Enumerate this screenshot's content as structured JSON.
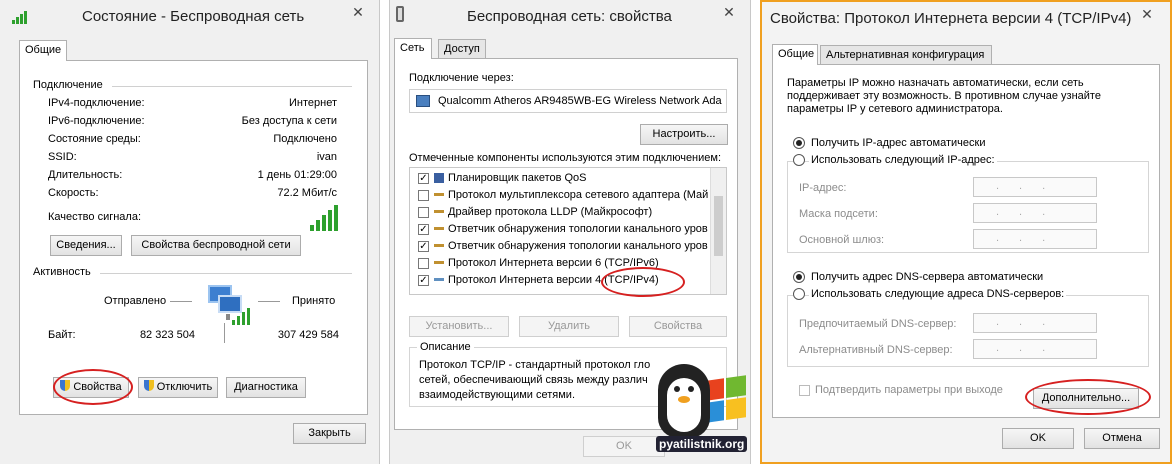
{
  "w1": {
    "title": "Состояние - Беспроводная сеть",
    "tab_general": "Общие",
    "section_connection": "Подключение",
    "rows": [
      {
        "label": "IPv4-подключение:",
        "value": "Интернет"
      },
      {
        "label": "IPv6-подключение:",
        "value": "Без доступа к сети"
      },
      {
        "label": "Состояние среды:",
        "value": "Подключено"
      },
      {
        "label": "SSID:",
        "value": "ivan"
      },
      {
        "label": "Длительность:",
        "value": "1 день 01:29:00"
      },
      {
        "label": "Скорость:",
        "value": "72.2 Мбит/с"
      }
    ],
    "signal_label": "Качество сигнала:",
    "btn_details": "Сведения...",
    "btn_wireless_props": "Свойства беспроводной сети",
    "section_activity": "Активность",
    "sent_label": "Отправлено",
    "received_label": "Принято",
    "bytes_label": "Байт:",
    "bytes_sent": "82 323 504",
    "bytes_received": "307 429 584",
    "btn_properties": "Свойства",
    "btn_disable": "Отключить",
    "btn_diagnose": "Диагностика",
    "btn_close": "Закрыть"
  },
  "w2": {
    "title": "Беспроводная сеть: свойства",
    "tab_network": "Сеть",
    "tab_access": "Доступ",
    "connect_via_label": "Подключение через:",
    "adapter_name": "Qualcomm Atheros AR9485WB-EG Wireless Network Ada",
    "btn_configure": "Настроить...",
    "components_label": "Отмеченные компоненты используются этим подключением:",
    "components": [
      {
        "checked": true,
        "label": "Планировщик пакетов QoS"
      },
      {
        "checked": false,
        "label": "Протокол мультиплексора сетевого адаптера (Май"
      },
      {
        "checked": false,
        "label": "Драйвер протокола LLDP (Майкрософт)"
      },
      {
        "checked": true,
        "label": "Ответчик обнаружения топологии канального уров"
      },
      {
        "checked": true,
        "label": "Ответчик обнаружения топологии канального уров"
      },
      {
        "checked": false,
        "label": "Протокол Интернета версии 6 (TCP/IPv6)"
      },
      {
        "checked": true,
        "label": "Протокол Интернета версии 4 (TCP/IPv4)"
      }
    ],
    "btn_install": "Установить...",
    "btn_remove": "Удалить",
    "btn_props": "Свойства",
    "description_title": "Описание",
    "description_lines": [
      "Протокол TCP/IP - стандартный протокол гло",
      "сетей, обеспечивающий связь между различ",
      "взаимодействующими сетями."
    ],
    "btn_ok": "OK"
  },
  "w3": {
    "title": "Свойства: Протокол Интернета версии 4 (TCP/IPv4)",
    "tab_general": "Общие",
    "tab_alt": "Альтернативная конфигурация",
    "intro_lines": [
      "Параметры IP можно назначать автоматически, если сеть",
      "поддерживает эту возможность. В противном случае узнайте",
      "параметры IP у сетевого администратора."
    ],
    "radio_ip_auto": "Получить IP-адрес автоматически",
    "radio_ip_manual": "Использовать следующий IP-адрес:",
    "ip_label": "IP-адрес:",
    "mask_label": "Маска подсети:",
    "gateway_label": "Основной шлюз:",
    "radio_dns_auto": "Получить адрес DNS-сервера автоматически",
    "radio_dns_manual": "Использовать следующие адреса DNS-серверов:",
    "dns_pref_label": "Предпочитаемый DNS-сервер:",
    "dns_alt_label": "Альтернативный DNS-сервер:",
    "validate_label": "Подтвердить параметры при выходе",
    "btn_advanced": "Дополнительно...",
    "btn_ok": "OK",
    "btn_cancel": "Отмена",
    "field_dots": "..."
  },
  "watermark": {
    "text": "pyatilistnik.org"
  },
  "colors": {
    "accent_orange": "#f0a020",
    "highlight_red": "#d62020",
    "signal_green": "#2ea02e"
  }
}
